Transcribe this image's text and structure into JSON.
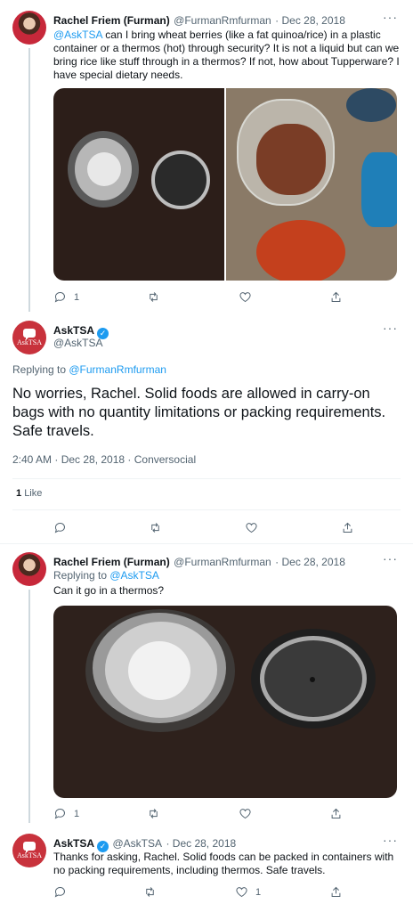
{
  "tweet1": {
    "display_name": "Rachel Friem (Furman)",
    "handle": "@FurmanRmfurman",
    "date": "· Dec 28, 2018",
    "mention": "@AskTSA",
    "text": " can I bring wheat berries  (like a fat quinoa/rice) in a plastic container or a thermos (hot) through security? It is not a liquid but can we bring rice like stuff through in a thermos? If not, how about Tupperware? I have special dietary needs.",
    "reply_count": "1"
  },
  "main_tweet": {
    "display_name": "AskTSA",
    "handle": "@AskTSA",
    "replying_prefix": "Replying to ",
    "replying_to": "@FurmanRmfurman",
    "text": "No worries, Rachel. Solid foods are allowed in carry-on bags with no quantity limitations or packing requirements. Safe travels.",
    "timestamp": "2:40 AM · Dec 28, 2018 · Conversocial",
    "likes_count": "1",
    "likes_label": "Like"
  },
  "tweet3": {
    "display_name": "Rachel Friem (Furman)",
    "handle": "@FurmanRmfurman",
    "date": "· Dec 28, 2018",
    "replying_prefix": "Replying to ",
    "replying_to": "@AskTSA",
    "text": "Can it go in a thermos?",
    "reply_count": "1"
  },
  "tweet4": {
    "display_name": "AskTSA",
    "handle": "@AskTSA",
    "date": "· Dec 28, 2018",
    "text": "Thanks for asking, Rachel. Solid foods can be packed in containers with no packing requirements, including thermos. Safe travels.",
    "like_count": "1"
  },
  "avatar_tsa_text": "AskTSA",
  "more_glyph": "···",
  "colors": {
    "accent": "#1d9bf0",
    "muted": "#536471",
    "tsa_red": "#c8323c"
  }
}
